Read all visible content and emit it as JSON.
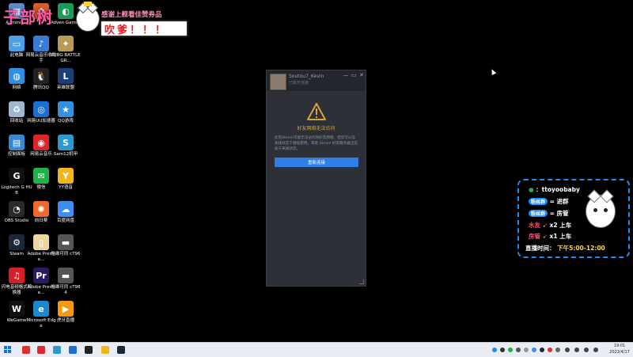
{
  "overlay": {
    "title": "子部树",
    "banner_top": "感谢上舰看佳赞券品",
    "banner_main": "吹爹！！！"
  },
  "desktop": {
    "icons": [
      {
        "label": "Adminis...",
        "color": "#5f88c8",
        "glyph": "▦"
      },
      {
        "label": "",
        "color": "#d95a2a",
        "glyph": "✿"
      },
      {
        "label": "Adven Games",
        "color": "#1e9a58",
        "glyph": "◐"
      },
      {
        "label": "此电脑",
        "color": "#4aa0e8",
        "glyph": "▭"
      },
      {
        "label": "网易云音乐收助手",
        "color": "#3a7bd5",
        "glyph": "♪"
      },
      {
        "label": "PUBG BATTLEGR...",
        "color": "#b89a56",
        "glyph": "✦"
      },
      {
        "label": "网络",
        "color": "#2f8fe0",
        "glyph": "◍"
      },
      {
        "label": "腾讯QQ",
        "color": "#222",
        "glyph": "🐧"
      },
      {
        "label": "英雄联盟",
        "color": "#1b3f77",
        "glyph": "L"
      },
      {
        "label": "回收站",
        "color": "#9fb8cf",
        "glyph": "♻"
      },
      {
        "label": "网易UU加速器",
        "color": "#1a6fd0",
        "glyph": "◎"
      },
      {
        "label": "QQ游戏",
        "color": "#3490e0",
        "glyph": "★"
      },
      {
        "label": "控制面板",
        "color": "#3a87d0",
        "glyph": "▤"
      },
      {
        "label": "网易云音乐",
        "color": "#d8282c",
        "glyph": "◉"
      },
      {
        "label": "Sam12机甲",
        "color": "#2a9ad0",
        "glyph": "S"
      },
      {
        "label": "Logitech G HUB",
        "color": "#111",
        "glyph": "G"
      },
      {
        "label": "微信",
        "color": "#22b04a",
        "glyph": "✉"
      },
      {
        "label": "YY语音",
        "color": "#f1b61c",
        "glyph": "Y"
      },
      {
        "label": "OBS Studio",
        "color": "#2a2a2a",
        "glyph": "◔"
      },
      {
        "label": "向日葵",
        "color": "#f06a28",
        "glyph": "✺"
      },
      {
        "label": "百度网盘",
        "color": "#3d8ef0",
        "glyph": "☁"
      },
      {
        "label": "Steam",
        "color": "#1b2838",
        "glyph": "⚙"
      },
      {
        "label": "Adobe Premie...",
        "color": "#e9d6a2",
        "glyph": "▯"
      },
      {
        "label": "皓维可同 cT96",
        "color": "#555",
        "glyph": "▬"
      },
      {
        "label": "闪电音频格式转换器",
        "color": "#d61f2a",
        "glyph": "♫"
      },
      {
        "label": "Adobe Premie...",
        "color": "#2a1a5e",
        "glyph": "Pr"
      },
      {
        "label": "皓维可同 cT984",
        "color": "#555",
        "glyph": "▬"
      },
      {
        "label": "WeGame",
        "color": "#111",
        "glyph": "W"
      },
      {
        "label": "Microsoft Edge",
        "color": "#1c88d0",
        "glyph": "e"
      },
      {
        "label": "虎牙直播",
        "color": "#f39a12",
        "glyph": "▶"
      }
    ]
  },
  "steam": {
    "username": "Soutou7_Kevin",
    "status": "已断开连接",
    "error_title": "好友网络无法访问",
    "description": "此刻Steam可能无法访问到好友网络，但您可以在离线状态下继续使用。或者 Steam 好友服务器当前处于离线状态。",
    "retry_label": "重新连接",
    "accent": "#2f7fe6",
    "warn_color": "#d6a53a"
  },
  "info_panel": {
    "wechat": "ttoyoobaby",
    "row1_pill": "粉丝群",
    "row1_text": "= 进群",
    "row2_pill": "粉丝群",
    "row2_text": "= 房管",
    "row3_label": "水友",
    "row3_text": "x2 上车",
    "row4_label": "房管",
    "row4_text": "x1 上车",
    "schedule_label": "直播时间：",
    "schedule_value": "下午5:00-12:00"
  },
  "taskbar": {
    "time": "19:01",
    "date": "2022/4/17",
    "apps": [
      {
        "name": "qq-icon",
        "color": "#e0302c"
      },
      {
        "name": "netease-icon",
        "color": "#d8282c"
      },
      {
        "name": "sam-icon",
        "color": "#2a9ad0"
      },
      {
        "name": "uu-icon",
        "color": "#1a6fd0"
      },
      {
        "name": "ghub-icon",
        "color": "#222"
      },
      {
        "name": "yy-icon",
        "color": "#f1b61c"
      },
      {
        "name": "steam-icon",
        "color": "#1b2838"
      }
    ]
  }
}
